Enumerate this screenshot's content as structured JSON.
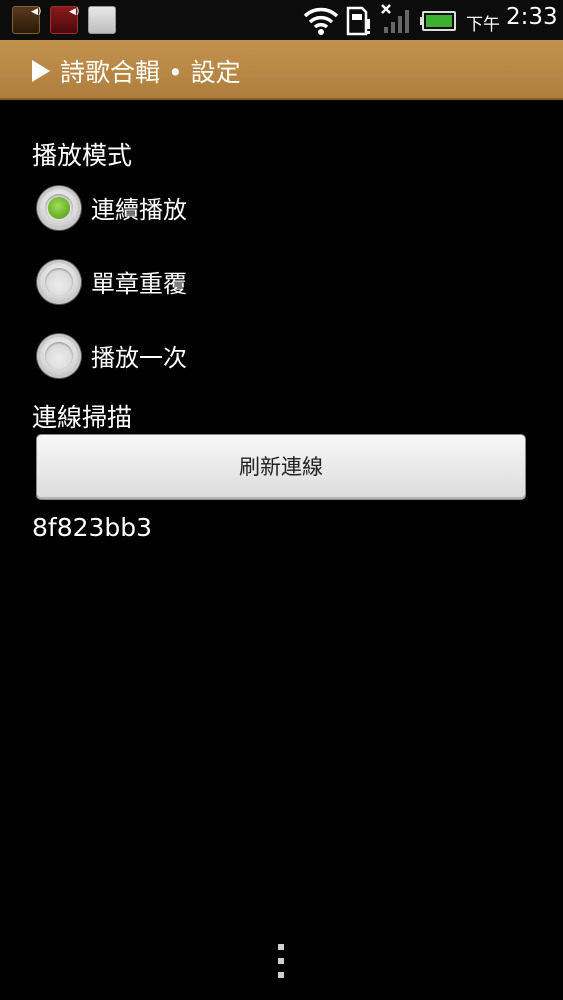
{
  "status_bar": {
    "ampm": "下午",
    "time": "2:33",
    "icons": [
      "notification-app-1-icon",
      "notification-app-2-icon",
      "notification-app-3-icon",
      "wifi-icon",
      "sd-card-icon",
      "signal-no-service-icon",
      "battery-icon"
    ],
    "battery_color": "#3cb030"
  },
  "title_bar": {
    "title": "詩歌合輯 • 設定",
    "background_color": "#bb8a46"
  },
  "play_mode": {
    "label": "播放模式",
    "options": [
      {
        "label": "連續播放",
        "selected": true
      },
      {
        "label": "單章重覆",
        "selected": false
      },
      {
        "label": "播放一次",
        "selected": false
      }
    ],
    "selected_color": "#6cb22a"
  },
  "connection": {
    "label": "連線掃描",
    "refresh_button": "刷新連線",
    "device_id": "8f823bb3"
  }
}
